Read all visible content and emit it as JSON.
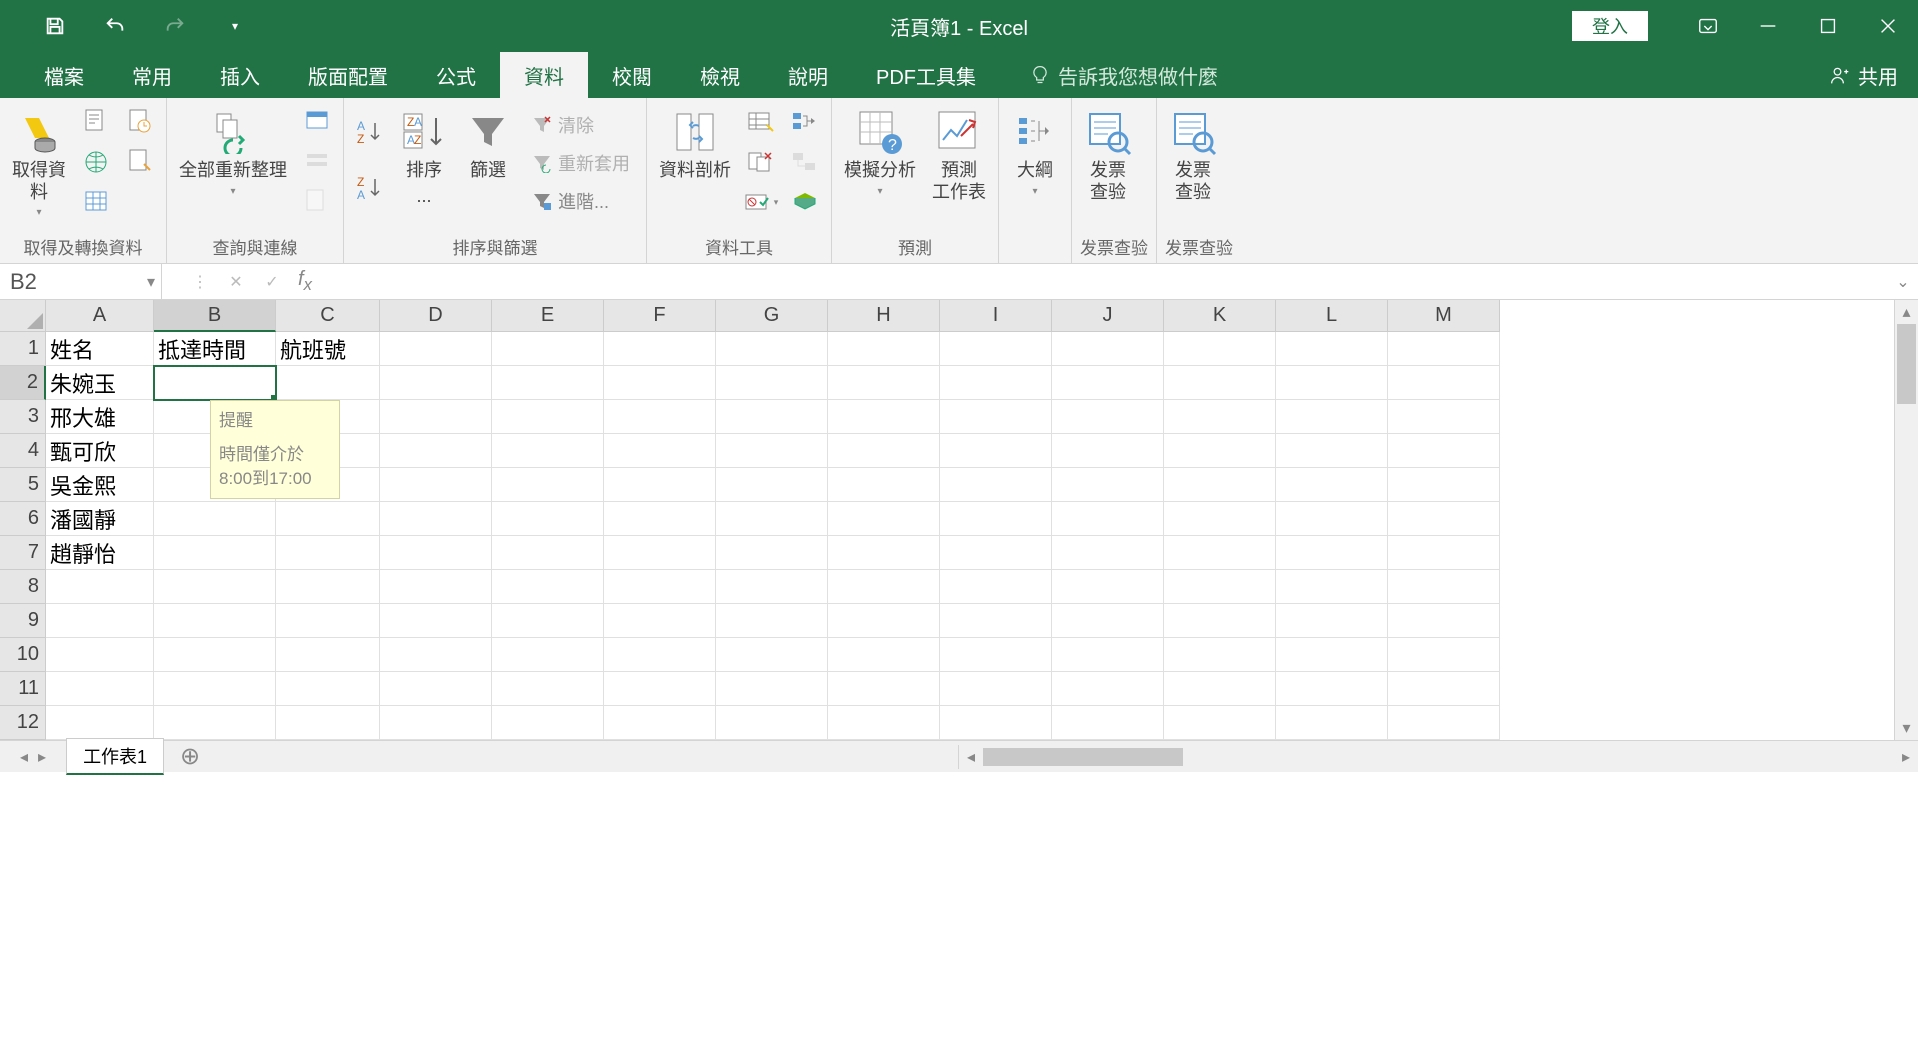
{
  "title": {
    "workbook": "活頁簿1",
    "app": "Excel",
    "signin": "登入"
  },
  "tabs": [
    "檔案",
    "常用",
    "插入",
    "版面配置",
    "公式",
    "資料",
    "校閱",
    "檢視",
    "說明",
    "PDF工具集"
  ],
  "active_tab": "資料",
  "tell_me": "告訴我您想做什麼",
  "share": "共用",
  "ribbon": {
    "group1": {
      "get_data": "取得資\n料",
      "label": "取得及轉換資料"
    },
    "group2": {
      "refresh": "全部重新整理",
      "label": "查詢與連線"
    },
    "group3": {
      "sort": "排序",
      "sort_dots": "...",
      "filter": "篩選",
      "clear": "清除",
      "reapply": "重新套用",
      "advanced": "進階...",
      "label": "排序與篩選"
    },
    "group4": {
      "text_to_cols": "資料剖析",
      "label": "資料工具"
    },
    "group5": {
      "whatif": "模擬分析",
      "forecast": "預測\n工作表",
      "label": "預測"
    },
    "group6": {
      "outline": "大綱"
    },
    "group7": {
      "invoice": "发票\n查验",
      "label": "发票查验"
    },
    "group8": {
      "invoice2": "发票\n查验",
      "label2": "发票查验"
    }
  },
  "name_box": "B2",
  "columns": [
    "A",
    "B",
    "C",
    "D",
    "E",
    "F",
    "G",
    "H",
    "I",
    "J",
    "K",
    "L",
    "M"
  ],
  "rows": [
    "1",
    "2",
    "3",
    "4",
    "5",
    "6",
    "7",
    "8",
    "9",
    "10",
    "11",
    "12"
  ],
  "headers": {
    "A": "姓名",
    "B": "抵達時間",
    "C": "航班號"
  },
  "names": [
    "朱婉玉",
    "邢大雄",
    "甄可欣",
    "吳金熙",
    "潘國靜",
    "趙靜怡"
  ],
  "active_cell": {
    "col": "B",
    "row": 2
  },
  "tooltip": {
    "title": "提醒",
    "body": "時間僅介於8:00到17:00"
  },
  "sheet": {
    "name": "工作表1"
  }
}
